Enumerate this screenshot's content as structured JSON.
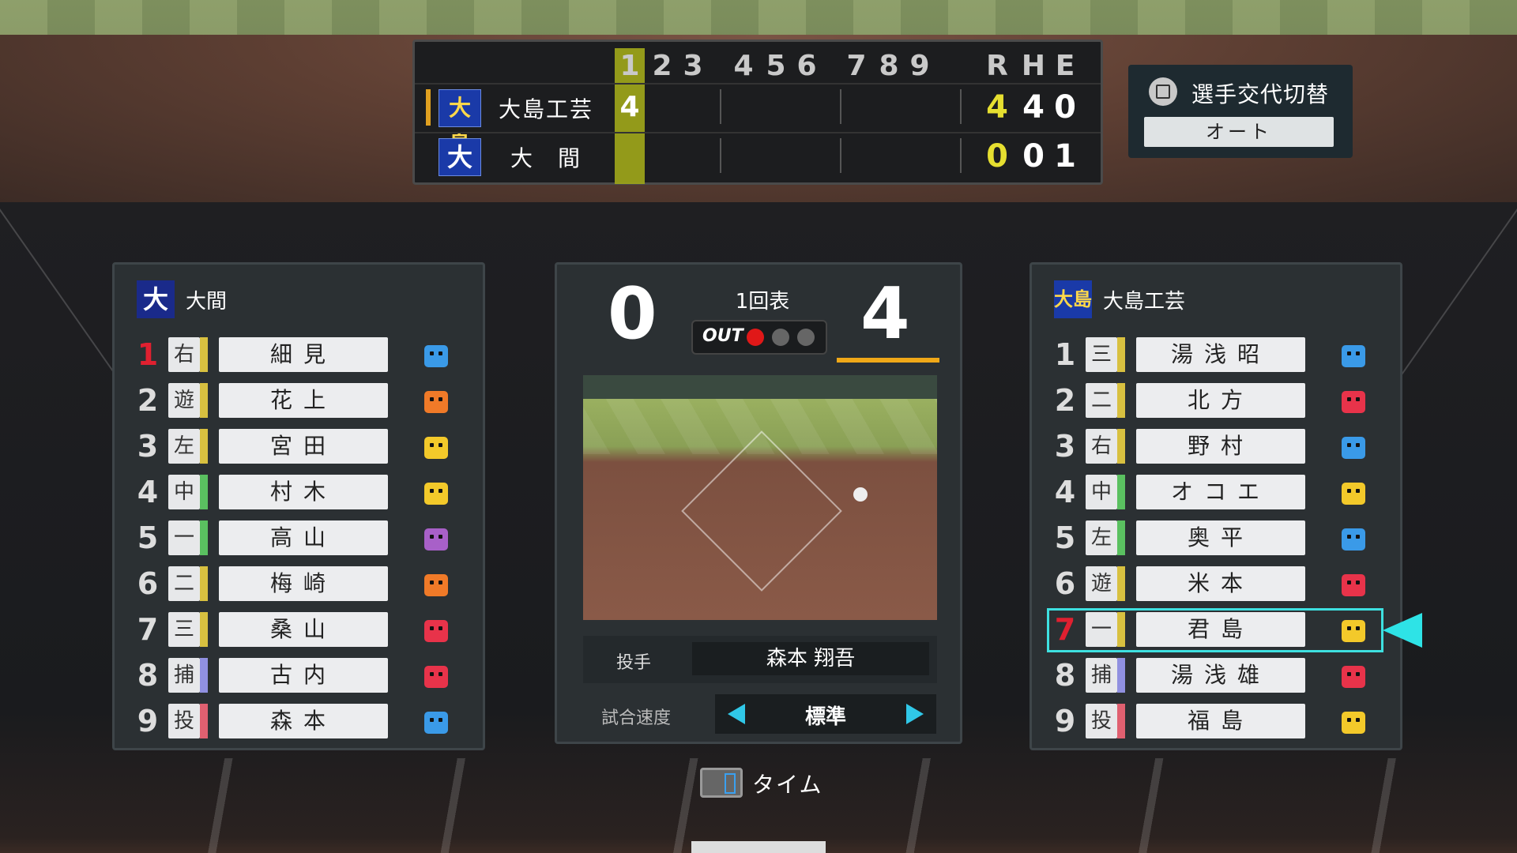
{
  "scoreboard": {
    "innings_header": [
      "1",
      "2",
      "3",
      "4",
      "5",
      "6",
      "7",
      "8",
      "9"
    ],
    "rhe_header": [
      "R",
      "H",
      "E"
    ],
    "away": {
      "logo": "大島",
      "name": "大島工芸",
      "inning1": "4",
      "R": "4",
      "H": "4",
      "E": "0"
    },
    "home": {
      "logo": "大",
      "name": "大　間",
      "inning1": "",
      "R": "0",
      "H": "0",
      "E": "1"
    }
  },
  "substitution": {
    "title": "選手交代切替",
    "value": "オート"
  },
  "left_panel": {
    "logo": "大",
    "team": "大間",
    "players": [
      {
        "num": "1",
        "pos": "右",
        "name": "細見",
        "face": "f-blue"
      },
      {
        "num": "2",
        "pos": "遊",
        "name": "花上",
        "face": "f-orange"
      },
      {
        "num": "3",
        "pos": "左",
        "name": "宮田",
        "face": "f-yellow"
      },
      {
        "num": "4",
        "pos": "中",
        "name": "村木",
        "face": "f-yellow"
      },
      {
        "num": "5",
        "pos": "一",
        "name": "高山",
        "face": "f-purple"
      },
      {
        "num": "6",
        "pos": "二",
        "name": "梅崎",
        "face": "f-orange"
      },
      {
        "num": "7",
        "pos": "三",
        "name": "桑山",
        "face": "f-red"
      },
      {
        "num": "8",
        "pos": "捕",
        "name": "古内",
        "face": "f-red"
      },
      {
        "num": "9",
        "pos": "投",
        "name": "森本",
        "face": "f-blue"
      }
    ]
  },
  "right_panel": {
    "logo": "大島",
    "team": "大島工芸",
    "players": [
      {
        "num": "1",
        "pos": "三",
        "name": "湯浅昭",
        "face": "f-blue"
      },
      {
        "num": "2",
        "pos": "二",
        "name": "北方",
        "face": "f-red"
      },
      {
        "num": "3",
        "pos": "右",
        "name": "野村",
        "face": "f-blue"
      },
      {
        "num": "4",
        "pos": "中",
        "name": "オコエ",
        "face": "f-yellow"
      },
      {
        "num": "5",
        "pos": "左",
        "name": "奥平",
        "face": "f-blue"
      },
      {
        "num": "6",
        "pos": "遊",
        "name": "米本",
        "face": "f-red"
      },
      {
        "num": "7",
        "pos": "一",
        "name": "君島",
        "face": "f-yellow"
      },
      {
        "num": "8",
        "pos": "捕",
        "name": "湯浅雄",
        "face": "f-red"
      },
      {
        "num": "9",
        "pos": "投",
        "name": "福島",
        "face": "f-yellow"
      }
    ],
    "selected_index": 6
  },
  "center": {
    "score_left": "0",
    "score_right": "4",
    "inning": "1回表",
    "out_label": "OUT",
    "outs": 1,
    "pitcher_label": "投手",
    "pitcher_name": "森本 翔吾",
    "speed_label": "試合速度",
    "speed_value": "標準"
  },
  "footer": {
    "time_label": "タイム"
  }
}
